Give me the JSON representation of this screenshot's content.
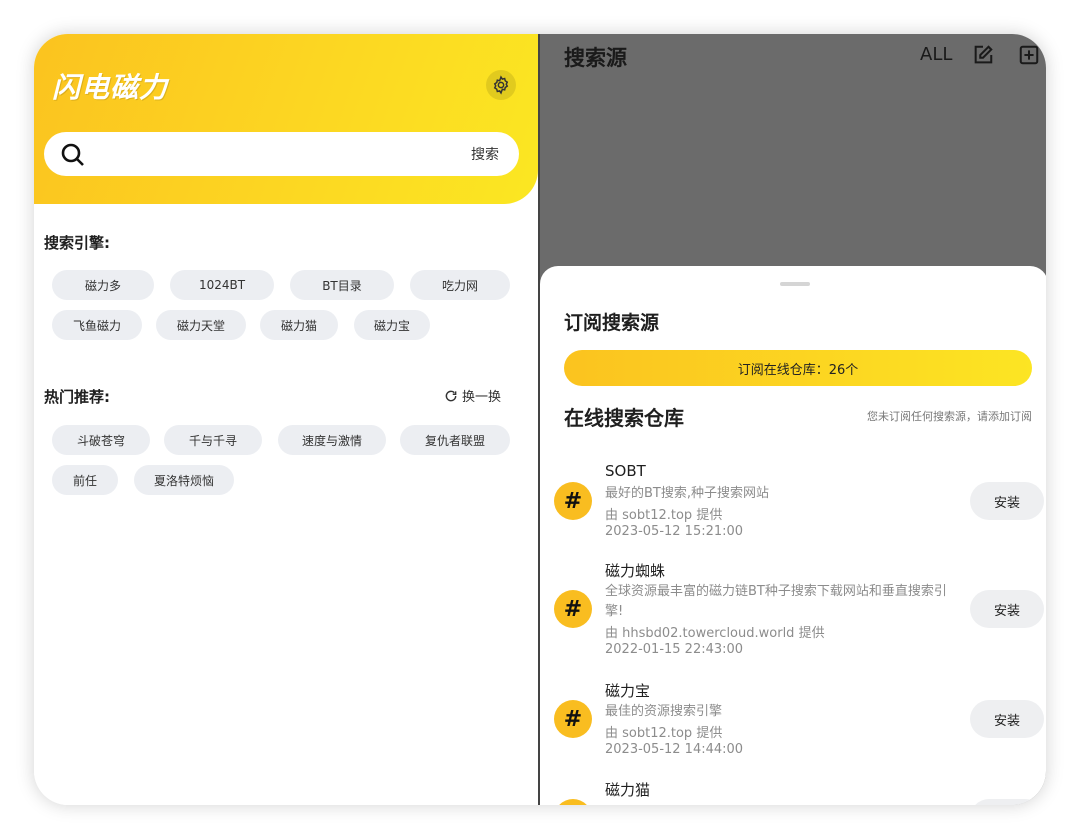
{
  "left": {
    "app_title": "闪电磁力",
    "search": {
      "placeholder": "",
      "button_label": "搜索"
    },
    "engines": {
      "title": "搜索引擎:",
      "chips": [
        "磁力多",
        "1024BT",
        "BT目录",
        "吃力网",
        "飞鱼磁力",
        "磁力天堂",
        "磁力猫",
        "磁力宝"
      ]
    },
    "hot": {
      "title": "热门推荐:",
      "refresh_label": "换一换",
      "chips": [
        "斗破苍穹",
        "千与千寻",
        "速度与激情",
        "复仇者联盟",
        "前任",
        "夏洛特烦恼"
      ]
    }
  },
  "right": {
    "header": {
      "title": "搜索源",
      "all_label": "ALL"
    },
    "sheet": {
      "title": "订阅搜索源",
      "subscribe_bar": "订阅在线仓库：26个",
      "repo_title": "在线搜索仓库",
      "repo_hint": "您未订阅任何搜索源，请添加订阅",
      "install_label": "安装",
      "items": [
        {
          "name": "SOBT",
          "desc": "最好的BT搜索,种子搜索网站",
          "provider": "由 sobt12.top 提供",
          "date": "2023-05-12 15:21:00"
        },
        {
          "name": "磁力蜘蛛",
          "desc": "全球资源最丰富的磁力链BT种子搜索下载网站和垂直搜索引擎!",
          "provider": "由 hhsbd02.towercloud.world 提供",
          "date": "2022-01-15 22:43:00"
        },
        {
          "name": "磁力宝",
          "desc": "最佳的资源搜索引擎",
          "provider": "由 sobt12.top 提供",
          "date": "2023-05-12 14:44:00"
        },
        {
          "name": "磁力猫",
          "desc": "",
          "provider": "",
          "date": ""
        }
      ]
    }
  },
  "colors": {
    "accent_yellow": "#fcd722",
    "hash_yellow": "#f9bd20",
    "overlay_gray": "#6b6b6b"
  },
  "icons": [
    "gear-icon",
    "search-icon",
    "refresh-icon",
    "edit-icon",
    "add-box-icon",
    "hash-icon"
  ]
}
